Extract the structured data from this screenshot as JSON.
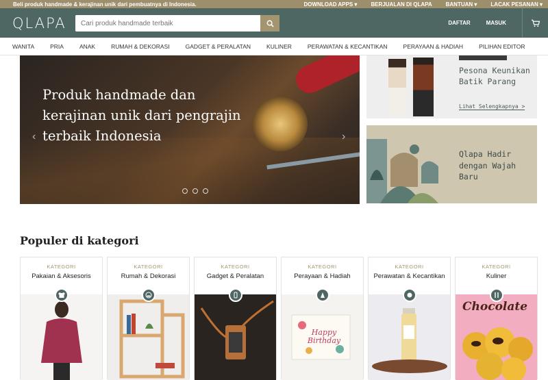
{
  "topbar": {
    "tagline": "Beli produk handmade & kerajinan unik dari pembuatnya di Indonesia.",
    "links": [
      "DOWNLOAD APPS ▾",
      "BERJUALAN DI QLAPA",
      "BANTUAN ▾",
      "LACAK PESANAN ▾"
    ]
  },
  "header": {
    "logo": "QLAPA",
    "search_placeholder": "Cari produk handmade terbaik",
    "daftar": "DAFTAR",
    "masuk": "MASUK"
  },
  "nav": [
    "WANITA",
    "PRIA",
    "ANAK",
    "RUMAH & DEKORASI",
    "GADGET & PERALATAN",
    "KULINER",
    "PERAWATAN & KECANTIKAN",
    "PERAYAAN & HADIAH",
    "PILIHAN EDITOR"
  ],
  "hero": {
    "headline": "Produk handmade dan kerajinan unik dari pengrajin terbaik Indonesia"
  },
  "banner1": {
    "title": "Pesona Keunikan Batik Parang",
    "link": "Lihat Selengkapnya >"
  },
  "banner2": {
    "title": "Qlapa Hadir dengan Wajah Baru"
  },
  "popular": {
    "title": "Populer di kategori",
    "kategori_label": "KATEGORI",
    "items": [
      {
        "name": "Pakaian & Aksesoris",
        "icon": "shirt-icon"
      },
      {
        "name": "Rumah & Dekorasi",
        "icon": "home-icon"
      },
      {
        "name": "Gadget & Peralatan",
        "icon": "phone-icon"
      },
      {
        "name": "Perayaan & Hadiah",
        "icon": "cake-icon"
      },
      {
        "name": "Perawatan & Kecantikan",
        "icon": "beauty-icon"
      },
      {
        "name": "Kuliner",
        "icon": "cutlery-icon"
      }
    ],
    "chocolate_text": "Chocolate",
    "card_text": "Happy Birthday"
  },
  "colors": {
    "brand": "#4f6763",
    "accent": "#a3956f",
    "topbar": "#9d8e6c"
  }
}
